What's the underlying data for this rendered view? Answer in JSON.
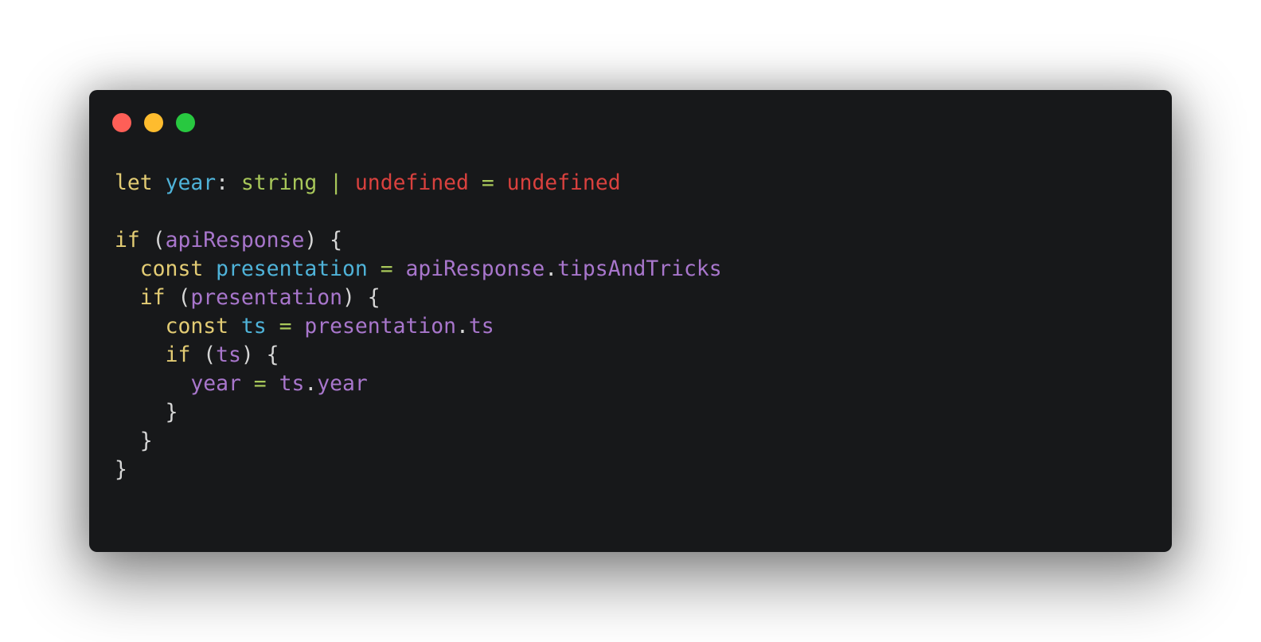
{
  "theme": {
    "background": "#17181a",
    "keyword": "#e3cc74",
    "declared_variable": "#4fb3d9",
    "type": "#a8c75a",
    "undefined": "#d9413e",
    "identifier": "#a876cc",
    "operator": "#a8c75a",
    "punctuation": "#d6d6d6"
  },
  "window_controls": [
    {
      "name": "close-dot",
      "color": "#fe5f57"
    },
    {
      "name": "minimize-dot",
      "color": "#febc2e"
    },
    {
      "name": "maximize-dot",
      "color": "#28c840"
    }
  ],
  "code_lines": [
    [
      {
        "t": "let",
        "k": "keyword"
      },
      {
        "t": " ",
        "k": "punctuation"
      },
      {
        "t": "year",
        "k": "declared_variable"
      },
      {
        "t": ": ",
        "k": "punctuation"
      },
      {
        "t": "string",
        "k": "type"
      },
      {
        "t": " ",
        "k": "punctuation"
      },
      {
        "t": "|",
        "k": "operator"
      },
      {
        "t": " ",
        "k": "punctuation"
      },
      {
        "t": "undefined",
        "k": "undefined"
      },
      {
        "t": " ",
        "k": "punctuation"
      },
      {
        "t": "=",
        "k": "operator"
      },
      {
        "t": " ",
        "k": "punctuation"
      },
      {
        "t": "undefined",
        "k": "undefined"
      }
    ],
    [],
    [
      {
        "t": "if",
        "k": "keyword"
      },
      {
        "t": " (",
        "k": "punctuation"
      },
      {
        "t": "apiResponse",
        "k": "identifier"
      },
      {
        "t": ") {",
        "k": "punctuation"
      }
    ],
    [
      {
        "t": "  ",
        "k": "punctuation"
      },
      {
        "t": "const",
        "k": "keyword"
      },
      {
        "t": " ",
        "k": "punctuation"
      },
      {
        "t": "presentation",
        "k": "declared_variable"
      },
      {
        "t": " ",
        "k": "punctuation"
      },
      {
        "t": "=",
        "k": "operator"
      },
      {
        "t": " ",
        "k": "punctuation"
      },
      {
        "t": "apiResponse",
        "k": "identifier"
      },
      {
        "t": ".",
        "k": "punctuation"
      },
      {
        "t": "tipsAndTricks",
        "k": "identifier"
      }
    ],
    [
      {
        "t": "  ",
        "k": "punctuation"
      },
      {
        "t": "if",
        "k": "keyword"
      },
      {
        "t": " (",
        "k": "punctuation"
      },
      {
        "t": "presentation",
        "k": "identifier"
      },
      {
        "t": ") {",
        "k": "punctuation"
      }
    ],
    [
      {
        "t": "    ",
        "k": "punctuation"
      },
      {
        "t": "const",
        "k": "keyword"
      },
      {
        "t": " ",
        "k": "punctuation"
      },
      {
        "t": "ts",
        "k": "declared_variable"
      },
      {
        "t": " ",
        "k": "punctuation"
      },
      {
        "t": "=",
        "k": "operator"
      },
      {
        "t": " ",
        "k": "punctuation"
      },
      {
        "t": "presentation",
        "k": "identifier"
      },
      {
        "t": ".",
        "k": "punctuation"
      },
      {
        "t": "ts",
        "k": "identifier"
      }
    ],
    [
      {
        "t": "    ",
        "k": "punctuation"
      },
      {
        "t": "if",
        "k": "keyword"
      },
      {
        "t": " (",
        "k": "punctuation"
      },
      {
        "t": "ts",
        "k": "identifier"
      },
      {
        "t": ") {",
        "k": "punctuation"
      }
    ],
    [
      {
        "t": "      ",
        "k": "punctuation"
      },
      {
        "t": "year",
        "k": "identifier"
      },
      {
        "t": " ",
        "k": "punctuation"
      },
      {
        "t": "=",
        "k": "operator"
      },
      {
        "t": " ",
        "k": "punctuation"
      },
      {
        "t": "ts",
        "k": "identifier"
      },
      {
        "t": ".",
        "k": "punctuation"
      },
      {
        "t": "year",
        "k": "identifier"
      }
    ],
    [
      {
        "t": "    ",
        "k": "punctuation"
      },
      {
        "t": "}",
        "k": "punctuation"
      }
    ],
    [
      {
        "t": "  ",
        "k": "punctuation"
      },
      {
        "t": "}",
        "k": "punctuation"
      }
    ],
    [
      {
        "t": "}",
        "k": "punctuation"
      }
    ]
  ]
}
